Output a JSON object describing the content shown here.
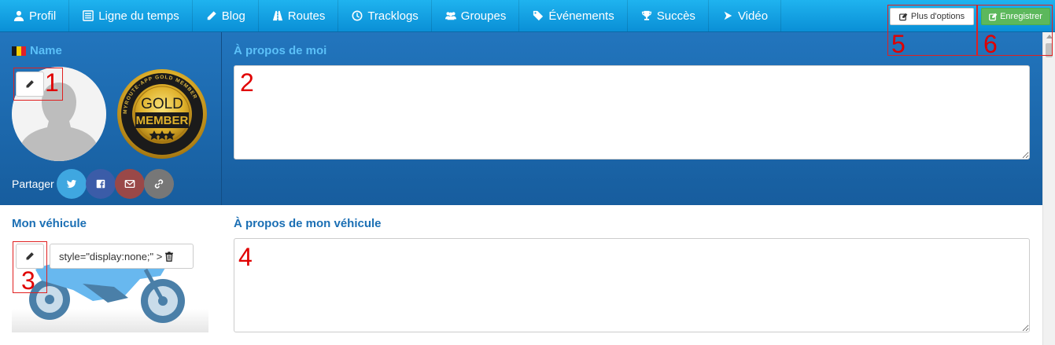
{
  "nav": {
    "items": [
      {
        "label": "Profil",
        "icon": "user-icon"
      },
      {
        "label": "Ligne du temps",
        "icon": "list-icon"
      },
      {
        "label": "Blog",
        "icon": "pencil-icon"
      },
      {
        "label": "Routes",
        "icon": "road-icon"
      },
      {
        "label": "Tracklogs",
        "icon": "clock-icon"
      },
      {
        "label": "Groupes",
        "icon": "group-icon"
      },
      {
        "label": "Événements",
        "icon": "tag-icon"
      },
      {
        "label": "Succès",
        "icon": "trophy-icon"
      },
      {
        "label": "Vidéo",
        "icon": "video-icon"
      }
    ],
    "more_options_label": "Plus d'options",
    "save_label": "Enregistrer"
  },
  "profile": {
    "name": "Name",
    "share_label": "Partager",
    "badge": {
      "line1": "GOLD",
      "line2": "MEMBER",
      "ring_text": "MYROUTE-APP GOLD MEMBER"
    }
  },
  "about": {
    "title": "À propos de moi",
    "value": ""
  },
  "vehicle": {
    "title": "Mon véhicule",
    "tag_text": "style=\"display:none;\" >",
    "about_title": "À propos de mon véhicule",
    "about_value": ""
  },
  "annotations": [
    "1",
    "2",
    "3",
    "4",
    "5",
    "6"
  ],
  "colors": {
    "nav_bg": "#1aa6e8",
    "panel_bg": "#1f6db5",
    "heading_light": "#5bc0f8",
    "heading_dark": "#1b6fb4",
    "save_green": "#5cb85c",
    "twitter": "#3fa7e0",
    "facebook": "#3b5ca8",
    "email": "#9a4848",
    "link": "#777777",
    "annotation_red": "#e00000"
  }
}
